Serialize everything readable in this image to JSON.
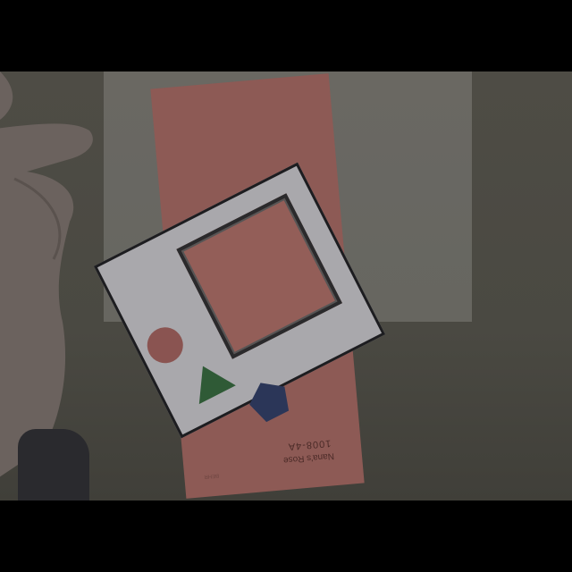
{
  "scene": {
    "description_colors": {
      "background": "#4a4942",
      "swatch": "#8d5a55",
      "card": "#a9a8ac",
      "window_fill": "#935e58",
      "circle": "#8a5451",
      "triangle": "#2f5a36",
      "pentagon": "#2b3658",
      "skin": "#6b625e"
    }
  },
  "swatch_card": {
    "code": "1008-4A",
    "name": "Nana's Rose",
    "brand": "BEHR"
  },
  "icons": [
    "circle-shape-icon",
    "triangle-shape-icon",
    "pentagon-shape-icon"
  ]
}
